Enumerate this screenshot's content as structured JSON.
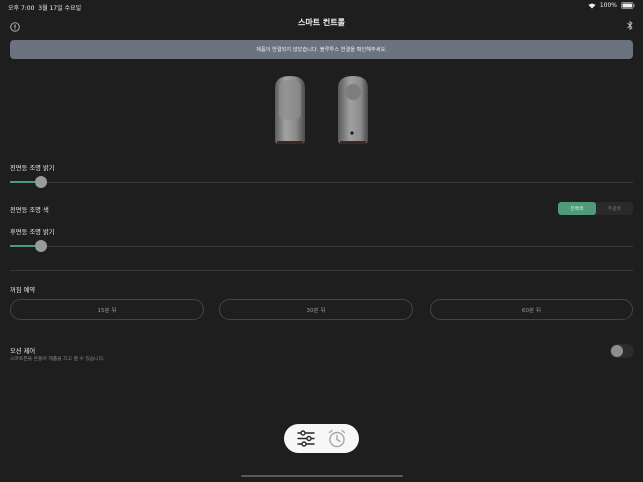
{
  "status_bar": {
    "time": "오후 7:00",
    "date": "3월 17일 수요일",
    "battery": "100%",
    "icons": [
      "wifi-icon",
      "battery-icon"
    ]
  },
  "header": {
    "title": "스마트 컨트롤",
    "left_icon": "info-icon",
    "right_icon": "bluetooth-icon"
  },
  "alert": {
    "message": "제품이 연결되지 않았습니다. 블루투스 연결을 확인해주세요."
  },
  "front_brightness": {
    "label": "전면등 조명 밝기",
    "value": 0.06
  },
  "front_color": {
    "label": "전면등 조명 색",
    "options": [
      "전백색",
      "주광색"
    ],
    "selected": "전백색"
  },
  "rear_brightness": {
    "label": "후면등 조명 밝기",
    "value": 0.06
  },
  "sleep_timer": {
    "label": "꺼짐 예약",
    "options": [
      "15분 뒤",
      "30분 뒤",
      "60분 뒤"
    ]
  },
  "motion_control": {
    "label": "모션 제어",
    "description": "스마트폰을 흔들어 제품을 끄고 켤 수 있습니다.",
    "enabled": false
  },
  "tab_bar": {
    "tabs": [
      "sliders-icon",
      "alarm-clock-icon"
    ],
    "selected": "sliders-icon"
  },
  "colors": {
    "background": "#1e1e1f",
    "accent": "#4f9a78",
    "banner": "#6b7280"
  }
}
